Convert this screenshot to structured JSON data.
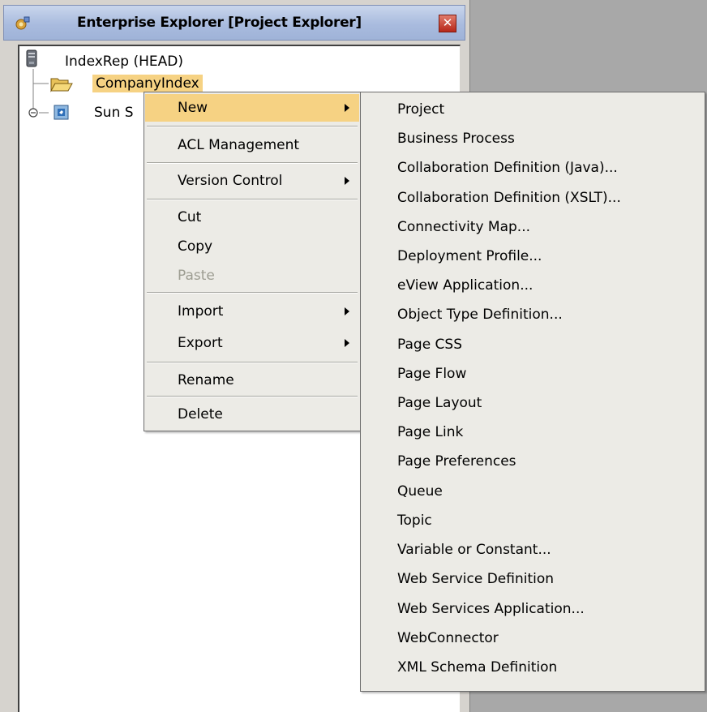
{
  "window": {
    "title": "Enterprise Explorer [Project Explorer]",
    "close_icon": "close-icon"
  },
  "tree": {
    "root": "IndexRep (HEAD)",
    "project": "CompanyIndex",
    "sun_item": "Sun S"
  },
  "context_menu": {
    "items": [
      {
        "label": "New",
        "submenu": true,
        "selected": true
      },
      {
        "label": "ACL Management"
      },
      {
        "label": "Version Control",
        "submenu": true
      },
      {
        "label": "Cut"
      },
      {
        "label": "Copy"
      },
      {
        "label": "Paste",
        "disabled": true
      },
      {
        "label": "Import",
        "submenu": true
      },
      {
        "label": "Export",
        "submenu": true
      },
      {
        "label": "Rename"
      },
      {
        "label": "Delete"
      }
    ]
  },
  "new_submenu": {
    "items": [
      "Project",
      "Business Process",
      "Collaboration Definition (Java)...",
      "Collaboration Definition (XSLT)...",
      "Connectivity Map...",
      "Deployment Profile...",
      "eView Application...",
      "Object Type Definition...",
      "Page CSS",
      "Page Flow",
      "Page Layout",
      "Page Link",
      "Page Preferences",
      "Queue",
      "Topic",
      "Variable or Constant...",
      "Web Service Definition",
      "Web Services Application...",
      "WebConnector",
      "XML Schema Definition"
    ]
  },
  "colors": {
    "selection": "#f6d283",
    "menu_bg": "#ecebe6",
    "title_gradient": "#a9bbde"
  }
}
